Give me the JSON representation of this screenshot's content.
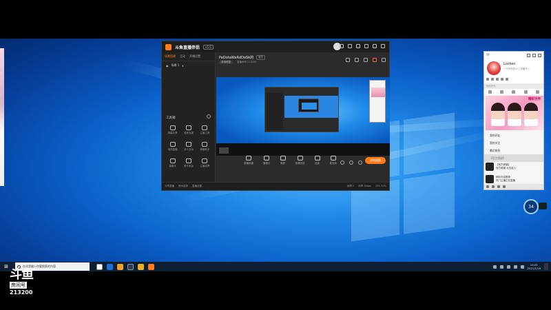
{
  "app": {
    "name": "斗鱼直播伴侣",
    "version": "v5.6",
    "left_tabs": [
      "场景搭建",
      "互动",
      "开播设置"
    ],
    "scene": "场景 1",
    "tools_title": "工具箱",
    "tools": [
      "屏幕共享",
      "语音连麦",
      "主播工具",
      "电视直播",
      "多人互动",
      "弹幕助手",
      "摄像头",
      "音乐电台",
      "主播投票"
    ],
    "room_title": "PaDotaWaRdDoSk的",
    "room_tag": "官方",
    "room_category": "英雄联盟",
    "room_meta": "直播间号 213200",
    "bottom_tools": [
      "直播设置",
      "摄像头",
      "美颜",
      "录屏回放",
      "连麦",
      "麦克风"
    ],
    "live_button": "开始直播",
    "status_left": [
      "分享直播",
      "房间装饰",
      "直播设置"
    ],
    "status_right": [
      "帧率 0",
      "码率 0kbps",
      "CPU 32%"
    ]
  },
  "chat": {
    "app_label": "YY",
    "user_name": "Locken",
    "signature": "一个好玩的人 | 风格不一",
    "search_placeholder": "搜索好友",
    "banner_title": "精彩世界",
    "list": [
      "我的好友",
      "我的关注",
      "最近联系"
    ],
    "selected_item": "【官方频道】",
    "messages": [
      {
        "title": "【官方频道】",
        "text": "官方频道  点击进入"
      },
      {
        "title": "精彩内容推荐",
        "text": "热门主播正在直播"
      }
    ]
  },
  "fps_widget": "34",
  "taskbar": {
    "search_placeholder": "在这里输入你要搜索的内容",
    "time": "19:05",
    "date": "2021/1/16"
  },
  "watermark": {
    "logo": "斗鱼",
    "room_label": "房间号",
    "room_number": "213200"
  },
  "colors": {
    "accent": "#ff7a1a",
    "taskbar": "#0f1f33",
    "desktop": "#1f86e6"
  }
}
